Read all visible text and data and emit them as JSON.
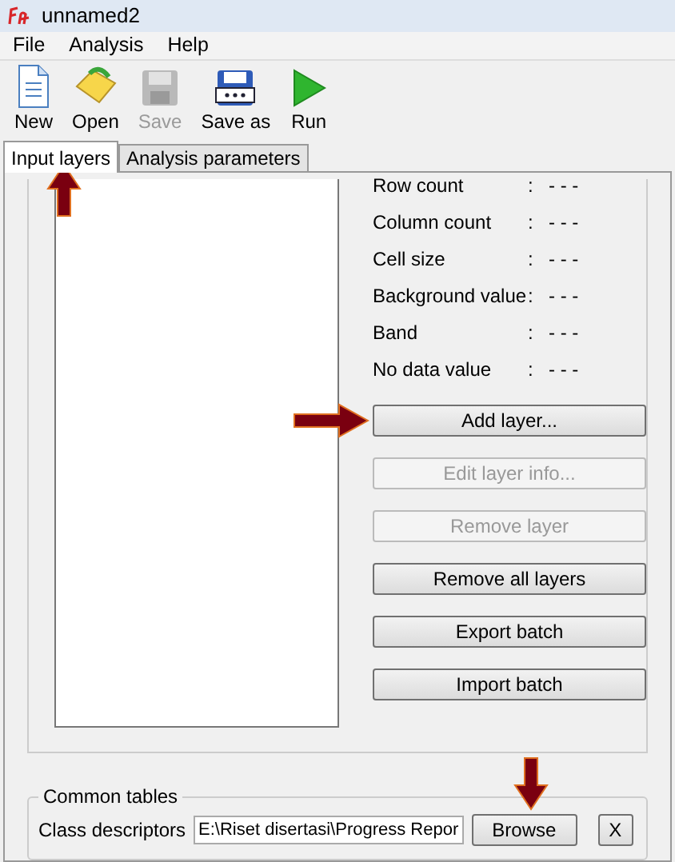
{
  "window": {
    "title": "unnamed2"
  },
  "menu": [
    "File",
    "Analysis",
    "Help"
  ],
  "toolbar": [
    {
      "kind": "new",
      "label": "New",
      "disabled": false
    },
    {
      "kind": "open",
      "label": "Open",
      "disabled": false
    },
    {
      "kind": "save",
      "label": "Save",
      "disabled": true
    },
    {
      "kind": "saveas",
      "label": "Save as",
      "disabled": false
    },
    {
      "kind": "run",
      "label": "Run",
      "disabled": false
    }
  ],
  "tabs": [
    {
      "label": "Input layers",
      "selected": true
    },
    {
      "label": "Analysis parameters",
      "selected": false
    }
  ],
  "properties": [
    {
      "label": "Row count",
      "value": "- - -"
    },
    {
      "label": "Column count",
      "value": "- - -"
    },
    {
      "label": "Cell size",
      "value": "- - -"
    },
    {
      "label": "Background value",
      "value": "- - -"
    },
    {
      "label": "Band",
      "value": "- - -"
    },
    {
      "label": "No data value",
      "value": "- - -"
    }
  ],
  "separator": ":",
  "buttons": [
    {
      "label": "Add layer...",
      "disabled": false,
      "arrow": true
    },
    {
      "label": "Edit layer info...",
      "disabled": true,
      "arrow": false
    },
    {
      "label": "Remove layer",
      "disabled": true,
      "arrow": false
    },
    {
      "label": "Remove all layers",
      "disabled": false,
      "arrow": false
    },
    {
      "label": "Export batch",
      "disabled": false,
      "arrow": false
    },
    {
      "label": "Import batch",
      "disabled": false,
      "arrow": false
    }
  ],
  "common_tables": {
    "title": "Common tables",
    "label": "Class descriptors",
    "value": "E:\\Riset disertasi\\Progress Repor",
    "browse": "Browse",
    "clear": "X"
  }
}
